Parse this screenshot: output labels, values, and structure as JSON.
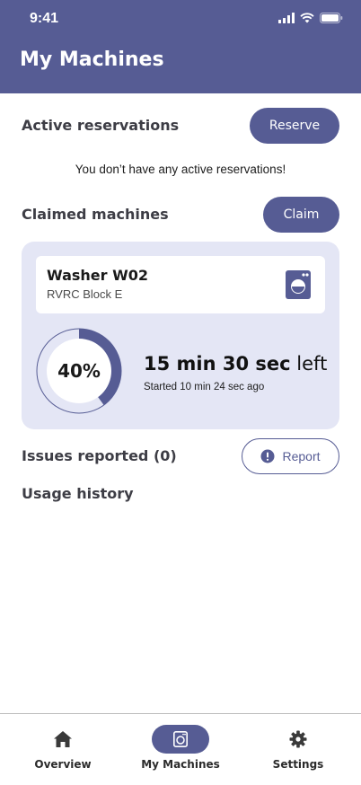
{
  "status_bar": {
    "time": "9:41"
  },
  "header": {
    "title": "My Machines"
  },
  "reservations": {
    "title": "Active reservations",
    "button_label": "Reserve",
    "empty_message": "You don’t have any active reservations!"
  },
  "claimed": {
    "title": "Claimed machines",
    "button_label": "Claim",
    "machine": {
      "name": "Washer W02",
      "location": "RVRC Block E",
      "progress_percent": 40,
      "progress_label": "40%",
      "time_left_bold": "15 min 30 sec",
      "time_left_suffix": "left",
      "started": "Started 10 min 24 sec ago"
    }
  },
  "issues": {
    "title": "Issues reported (0)",
    "button_label": "Report"
  },
  "usage": {
    "title": "Usage history"
  },
  "nav": {
    "items": [
      {
        "label": "Overview",
        "icon": "home-icon"
      },
      {
        "label": "My Machines",
        "icon": "washer-icon",
        "active": true
      },
      {
        "label": "Settings",
        "icon": "gear-icon"
      }
    ]
  },
  "colors": {
    "primary": "#565c94",
    "card_bg": "#e4e6f5"
  }
}
